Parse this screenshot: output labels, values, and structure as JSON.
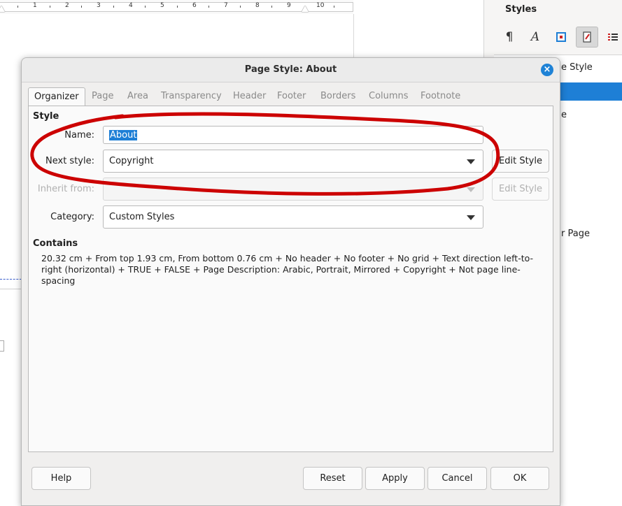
{
  "ruler": {
    "numbers": [
      "1",
      "2",
      "3",
      "4",
      "5",
      "6",
      "7",
      "8",
      "9",
      "10"
    ]
  },
  "sidebar": {
    "title": "Styles",
    "toolbar_icons": [
      "paragraph-styles-icon",
      "character-styles-icon",
      "frame-styles-icon",
      "page-styles-icon",
      "list-styles-icon"
    ],
    "visible_items": [
      {
        "label": "e Style",
        "selected": false
      },
      {
        "label": "",
        "selected": true
      },
      {
        "label": "e",
        "selected": false
      },
      {
        "label": "r Page",
        "selected": false
      }
    ]
  },
  "dialog": {
    "title": "Page Style: About",
    "tabs": [
      {
        "label": "Organizer",
        "active": true
      },
      {
        "label": "Page",
        "active": false
      },
      {
        "label": "Area",
        "active": false
      },
      {
        "label": "Transparency",
        "active": false
      },
      {
        "label": "Header",
        "active": false
      },
      {
        "label": "Footer",
        "active": false
      },
      {
        "label": "Borders",
        "active": false
      },
      {
        "label": "Columns",
        "active": false
      },
      {
        "label": "Footnote",
        "active": false
      }
    ],
    "style_section": {
      "heading": "Style",
      "name_label": "Name:",
      "name_value": "About",
      "next_style_label": "Next style:",
      "next_style_value": "Copyright",
      "edit_style_label": "Edit Style",
      "inherit_from_label": "Inherit from:",
      "inherit_from_value": "",
      "edit_style_disabled_label": "Edit Style",
      "category_label": "Category:",
      "category_value": "Custom Styles"
    },
    "contains_section": {
      "heading": "Contains",
      "text": "20.32 cm + From top 1.93 cm, From bottom 0.76 cm + No header + No footer + No grid + Text direction left-to-right (horizontal) + TRUE + FALSE + Page Description: Arabic, Portrait, Mirrored + Copyright + Not page line-spacing"
    },
    "buttons": {
      "help": "Help",
      "reset": "Reset",
      "apply": "Apply",
      "cancel": "Cancel",
      "ok": "OK"
    }
  },
  "colors": {
    "accent": "#1e7fd6",
    "annotation": "#cc0000"
  }
}
